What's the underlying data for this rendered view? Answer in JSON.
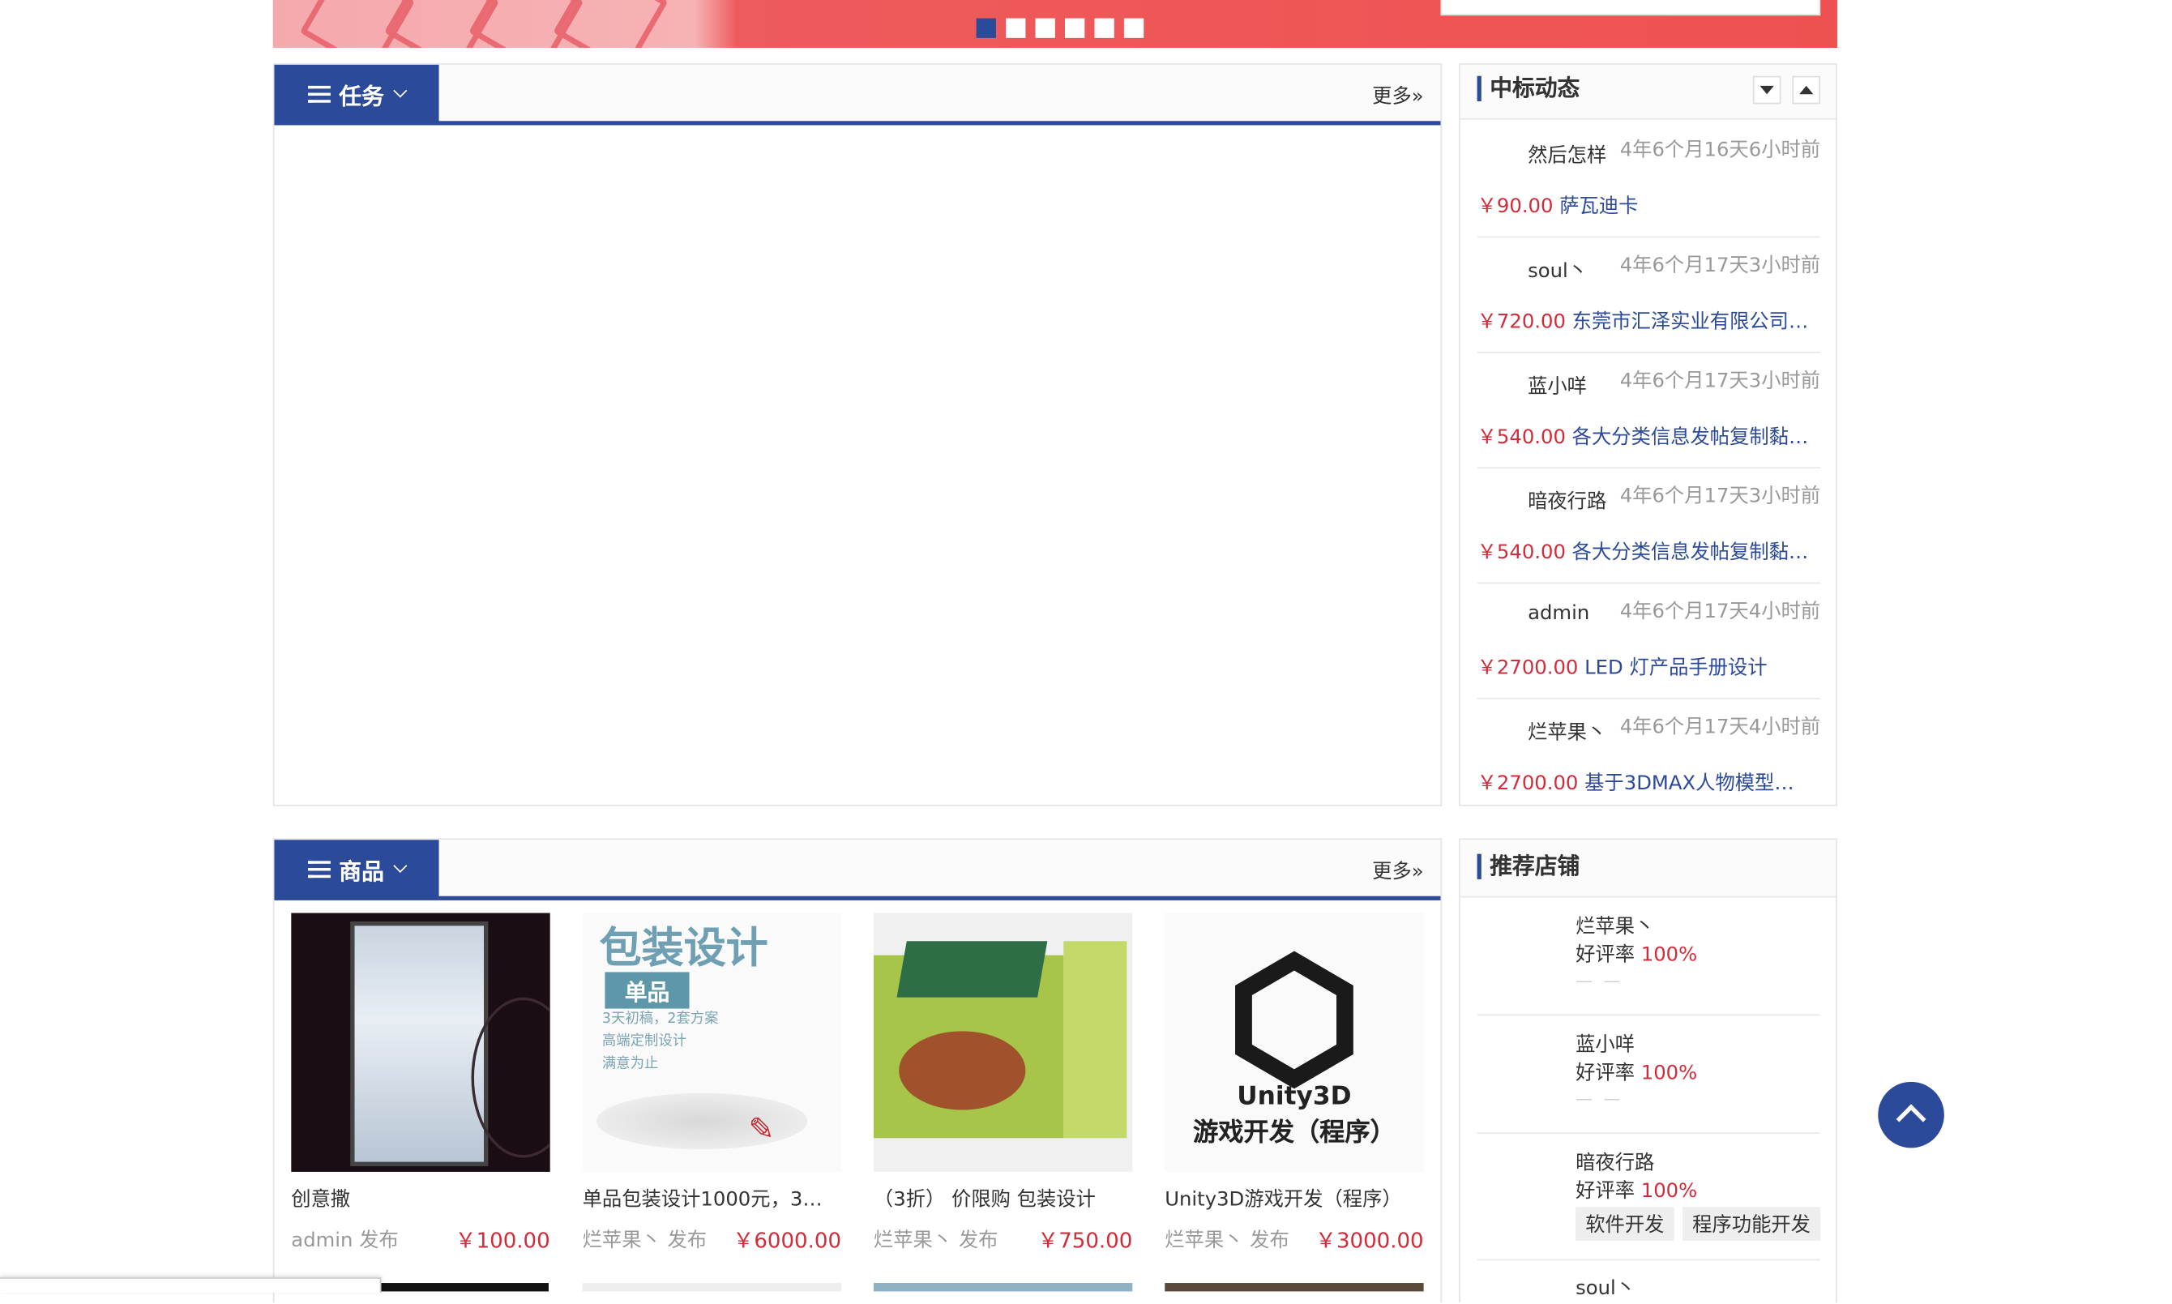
{
  "tasks_panel": {
    "tab_label": "任务",
    "more_label": "更多»"
  },
  "bids_panel": {
    "title": "中标动态",
    "items": [
      {
        "user": "然后怎样",
        "time": "4年6个月16天6小时前",
        "price": "￥90.00",
        "title": "萨瓦迪卡"
      },
      {
        "user": "soul丶",
        "time": "4年6个月17天3小时前",
        "price": "￥720.00",
        "title": "东莞市汇泽实业有限公司…"
      },
      {
        "user": "蓝小咩",
        "time": "4年6个月17天3小时前",
        "price": "￥540.00",
        "title": "各大分类信息发帖复制黏…"
      },
      {
        "user": "暗夜行路",
        "time": "4年6个月17天3小时前",
        "price": "￥540.00",
        "title": "各大分类信息发帖复制黏…"
      },
      {
        "user": "admin",
        "time": "4年6个月17天4小时前",
        "price": "￥2700.00",
        "title": "LED 灯产品手册设计"
      },
      {
        "user": "烂苹果丶",
        "time": "4年6个月17天4小时前",
        "price": "￥2700.00",
        "title": "基于3DMAX人物模型…"
      }
    ]
  },
  "goods_panel": {
    "tab_label": "商品",
    "more_label": "更多»",
    "items": [
      {
        "title": "创意撒",
        "publisher": "admin 发布",
        "price": "￥100.00"
      },
      {
        "title": "单品包装设计1000元，3…",
        "publisher": "烂苹果丶 发布",
        "price": "￥6000.00",
        "img_text": {
          "t1": "包装设计",
          "t2": "单品",
          "t3": "3天初稿，2套方案",
          "t4": "高端定制设计",
          "t5": "满意为止"
        }
      },
      {
        "title": "（3折） 价限购 包装设计",
        "publisher": "烂苹果丶 发布",
        "price": "￥750.00"
      },
      {
        "title": "Unity3D游戏开发（程序）",
        "publisher": "烂苹果丶 发布",
        "price": "￥3000.00",
        "img_text": {
          "l1": "Unity3D",
          "l2": "游戏开发（程序）"
        }
      }
    ]
  },
  "shops_panel": {
    "title": "推荐店铺",
    "items": [
      {
        "name": "烂苹果丶",
        "rate_label": "好评率",
        "rate": "100%",
        "dash": "— —"
      },
      {
        "name": "蓝小咩",
        "rate_label": "好评率",
        "rate": "100%",
        "dash": "— —"
      },
      {
        "name": "暗夜行路",
        "rate_label": "好评率",
        "rate": "100%",
        "tags": [
          "软件开发",
          "程序功能开发"
        ]
      },
      {
        "name": "soul丶"
      }
    ]
  }
}
